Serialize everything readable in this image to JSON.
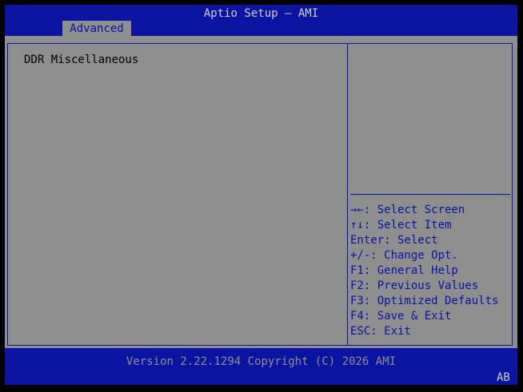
{
  "app": {
    "title": "Aptio Setup – AMI"
  },
  "tabs": [
    {
      "label": "Advanced",
      "active": true
    }
  ],
  "main": {
    "items": [
      {
        "label": "DDR Miscellaneous"
      }
    ]
  },
  "help": {
    "keys": [
      {
        "text": "→←: Select Screen",
        "icon": "left-right-arrows-icon"
      },
      {
        "text": "↑↓: Select Item",
        "icon": "up-down-arrows-icon"
      },
      {
        "text": "Enter: Select"
      },
      {
        "text": "+/-: Change Opt."
      },
      {
        "text": "F1: General Help"
      },
      {
        "text": "F2: Previous Values"
      },
      {
        "text": "F3: Optimized Defaults"
      },
      {
        "text": "F4: Save & Exit"
      },
      {
        "text": "ESC: Exit"
      }
    ]
  },
  "footer": {
    "version": "Version 2.22.1294 Copyright (C) 2026 AMI",
    "badge": "AB"
  },
  "colors": {
    "background_blue": "#0a14a0",
    "panel_gray": "#8e8e8e",
    "title_text": "#cfcfcf",
    "help_text": "#0a14a0",
    "item_text": "#000000"
  }
}
